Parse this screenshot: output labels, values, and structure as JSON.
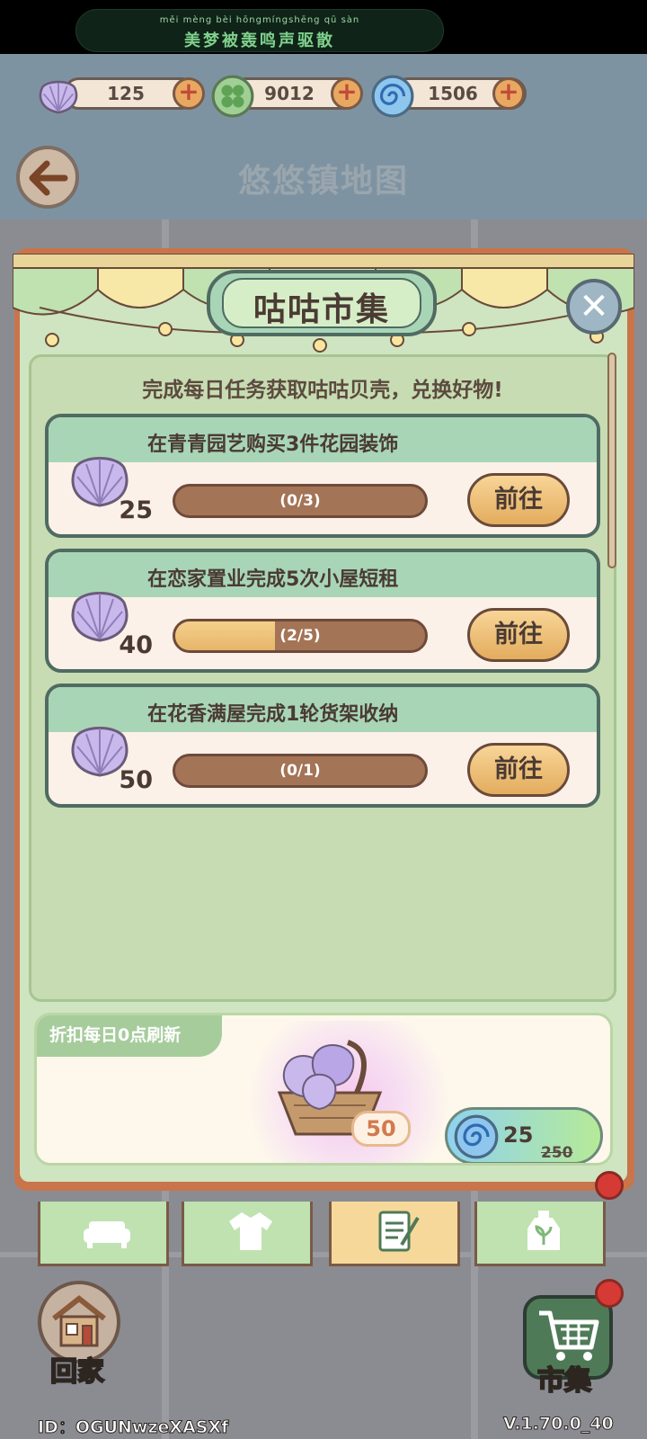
{
  "notice": {
    "pinyin": "měi mèng bèi hōngmíngshēng qū sàn",
    "text": "美梦被轰鸣声驱散"
  },
  "currencies": [
    {
      "icon": "shell-icon",
      "value": "125"
    },
    {
      "icon": "clover-icon",
      "value": "9012"
    },
    {
      "icon": "swirl-icon",
      "value": "1506"
    }
  ],
  "header": {
    "title": "悠悠镇地图"
  },
  "panel": {
    "title": "咕咕市集",
    "subtitle": "完成每日任务获取咕咕贝壳，兑换好物!",
    "tasks": [
      {
        "title": "在青青园艺购买3件花园装饰",
        "reward": "25",
        "progress_text": "(0/3)",
        "progress": 0.0,
        "button": "前往"
      },
      {
        "title": "在恋家置业完成5次小屋短租",
        "reward": "40",
        "progress_text": "(2/5)",
        "progress": 0.4,
        "button": "前往"
      },
      {
        "title": "在花香满屋完成1轮货架收纳",
        "reward": "50",
        "progress_text": "(0/1)",
        "progress": 0.0,
        "button": "前往"
      }
    ],
    "deal": {
      "tag": "折扣每日0点刷新",
      "item_count": "50",
      "price": "25",
      "original_price": "250"
    }
  },
  "tabs": [
    {
      "icon": "sofa-icon"
    },
    {
      "icon": "shirt-icon"
    },
    {
      "icon": "notepad-icon",
      "active": true
    },
    {
      "icon": "plant-bottle-icon"
    }
  ],
  "bottom": {
    "home_label": "回家",
    "market_label": "市集",
    "user_id": "ID：OGUNwzeXASXf",
    "version": "V.1.70.0_40"
  },
  "colors": {
    "panel_frame": "#c9744a",
    "panel_bg": "#cfe4c0",
    "task_header": "#a8d5b6",
    "button": "#e3ac5e",
    "progress_track": "#a47456",
    "progress_fill": "#e7b56a"
  }
}
